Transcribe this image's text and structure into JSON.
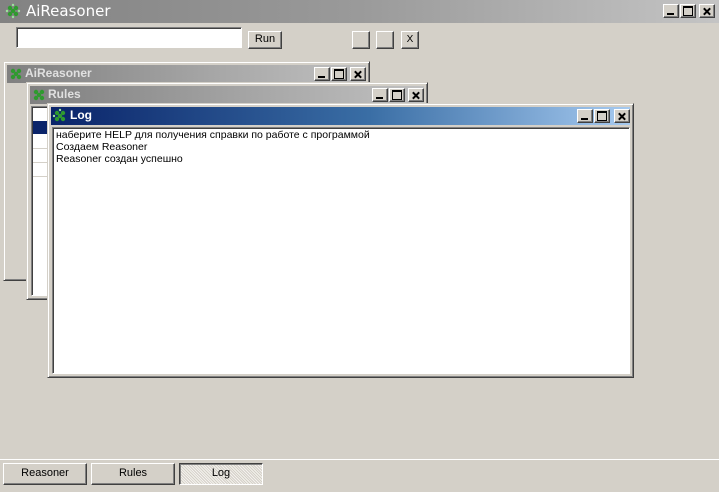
{
  "app": {
    "title": "AiReasoner"
  },
  "toolbar": {
    "command_value": "",
    "run_label": "Run",
    "button2_label": "",
    "button3_label": "",
    "close_label": "X"
  },
  "windows": {
    "aireasoner": {
      "title": "AiReasoner"
    },
    "rules": {
      "title": "Rules"
    },
    "log": {
      "title": "Log",
      "lines": [
        "наберите HELP для получения справки по работе с программой",
        "Создаем Reasoner",
        "Reasoner создан успешно"
      ]
    }
  },
  "tabs": [
    {
      "label": "Reasoner",
      "active": false
    },
    {
      "label": "Rules",
      "active": false
    },
    {
      "label": "Log",
      "active": true
    }
  ],
  "colors": {
    "face": "#d4d0c8",
    "active_title_start": "#0a246a",
    "active_title_end": "#a6caf0",
    "inactive_title": "#808080",
    "selection": "#0a246a"
  },
  "icons": {
    "app": "gear-cluster-icon"
  }
}
